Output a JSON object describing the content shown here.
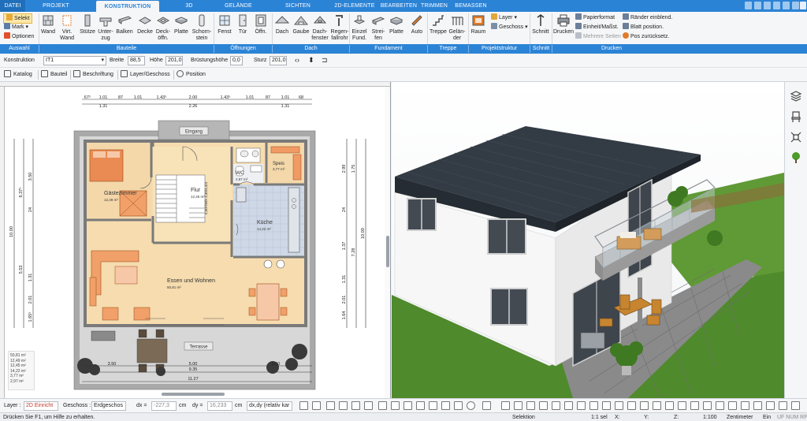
{
  "tabs": [
    "DATEI",
    "PROJEKT",
    "KONSTRUKTION",
    "3D",
    "GELÄNDE",
    "SICHTEN",
    "2D-ELEMENTE",
    "BEARBEITEN",
    "TRIMMEN",
    "BEMASSEN"
  ],
  "active_tab": "KONSTRUKTION",
  "ribbon": {
    "auswahl": {
      "select": "Selekt",
      "mark": "Mark",
      "options": "Optionen"
    },
    "bauteile": [
      {
        "l1": "Wand",
        "l2": ""
      },
      {
        "l1": "Virt.",
        "l2": "Wand"
      },
      {
        "l1": "Stütze",
        "l2": ""
      },
      {
        "l1": "Unter-",
        "l2": "zug"
      },
      {
        "l1": "Balken",
        "l2": ""
      },
      {
        "l1": "Decke",
        "l2": ""
      },
      {
        "l1": "Deck-",
        "l2": "öffn."
      },
      {
        "l1": "Platte",
        "l2": ""
      },
      {
        "l1": "Schorn-",
        "l2": "stein"
      }
    ],
    "oeffnungen": [
      {
        "l1": "Fenst",
        "l2": ""
      },
      {
        "l1": "Tür",
        "l2": ""
      },
      {
        "l1": "Öffn.",
        "l2": ""
      }
    ],
    "dach": [
      {
        "l1": "Dach",
        "l2": ""
      },
      {
        "l1": "Gaube",
        "l2": ""
      },
      {
        "l1": "Dach-",
        "l2": "fenster"
      },
      {
        "l1": "Regen-",
        "l2": "fallrohr"
      }
    ],
    "fundament": [
      {
        "l1": "Einzel",
        "l2": "Fund."
      },
      {
        "l1": "Strei-",
        "l2": "fen"
      },
      {
        "l1": "Platte",
        "l2": ""
      },
      {
        "l1": "Auto",
        "l2": ""
      }
    ],
    "treppe": [
      {
        "l1": "Treppe",
        "l2": ""
      },
      {
        "l1": "Gelän-",
        "l2": "der"
      }
    ],
    "projektstruktur": {
      "raum": "Raum",
      "layer": "Layer",
      "geschoss": "Geschoss"
    },
    "schnitt": "Schnitt",
    "drucken": {
      "drucken": "Drucken",
      "papierformat": "Papierformat",
      "einheit": "Einheit/Maßst.",
      "mehrere": "Mehrere Seiten",
      "raender": "Ränder einblend.",
      "blatt": "Blatt position.",
      "pos": "Pos zurücksetz."
    },
    "groups": [
      "Auswahl",
      "Bauteile",
      "Öffnungen",
      "Dach",
      "Fundament",
      "Treppe",
      "Projektstruktur",
      "Schnitt",
      "Drucken"
    ]
  },
  "propbar": {
    "label": "Konstruktion",
    "type": "IT1",
    "breite_label": "Breite",
    "breite": "88,5",
    "hoehe_label": "Höhe",
    "hoehe": "201,0",
    "bruestung_label": "Brüstungshöhe",
    "bruestung": "0,0",
    "sturz_label": "Sturz",
    "sturz": "201,0"
  },
  "toolbar2": [
    "Katalog",
    "Bauteil",
    "Beschriftung",
    "Layer/Geschoss",
    "Position"
  ],
  "plan": {
    "rooms": {
      "eingang": "Eingang",
      "wc": "WC",
      "wc_area": "2,97 m²",
      "speis": "Speis",
      "speis_area": "3,77 m²",
      "gaestezimmer": "Gästezimmer",
      "gaestezimmer_area": "12,49 m²",
      "flur": "Flur",
      "flur_area": "12,45 m²",
      "kueche": "Küche",
      "kueche_area": "14,22 m²",
      "essen": "Essen und Wohnen",
      "essen_area": "50,81 m²",
      "terrasse": "Terrasse",
      "stairs": "5,00/Tiefe 3,40/4,4/4"
    },
    "dims_top_row1": [
      "67⁵",
      "1.01",
      "87",
      "1.01",
      "1.43⁵",
      "2.00",
      "1.43⁵",
      "1.01",
      "87",
      "1.01",
      "68"
    ],
    "dims_top_row2": [
      "1.31",
      "2.26",
      "1.31"
    ],
    "dims_bottom": [
      "3.50",
      "5.00",
      "3.50"
    ],
    "dims_bottom2": "9.35",
    "dims_bottom3": "11.27",
    "dims_left": [
      "6.37⁵",
      "10.00",
      "5.53",
      "1.31",
      "3.50",
      "2.01",
      "1.65⁵",
      "24"
    ],
    "dims_right": [
      "2.99",
      "1.75",
      "7.28",
      "1.37",
      "10.00",
      "1.64",
      "2.01",
      "1.31",
      "24"
    ],
    "areas_list": [
      "50,81 m²",
      "12,49 m²",
      "12,45 m²",
      "14,22 m²",
      "3,77 m²",
      "2,97 m²"
    ]
  },
  "bottombar": {
    "layer_label": "Layer :",
    "layer_value": "2D Einricht",
    "geschoss_label": "Geschoss :",
    "geschoss_value": "Erdgeschos",
    "dx_label": "dx =",
    "dx_value": "-227,3",
    "dx_unit": "cm",
    "dy_label": "dy =",
    "dy_value": "16,233",
    "dy_unit": "cm",
    "mode": "dx,dy (relativ kar"
  },
  "status": {
    "hint": "Drücken Sie F1, um Hilfe zu erhalten.",
    "selektion": "Selektion",
    "scale": "1:1 sel",
    "x": "X:",
    "y": "Y:",
    "z": "Z:",
    "ratio": "1:100",
    "unit": "Zentimeter",
    "ein": "Ein",
    "flags": "UF NUM RF"
  },
  "colors": {
    "accent": "#2b83d6",
    "roof": "#333b44",
    "wall": "#f4f4f4",
    "floor": "#f4d8aa",
    "grass": "#4f8a2c",
    "terrace": "#8d8d8d"
  }
}
